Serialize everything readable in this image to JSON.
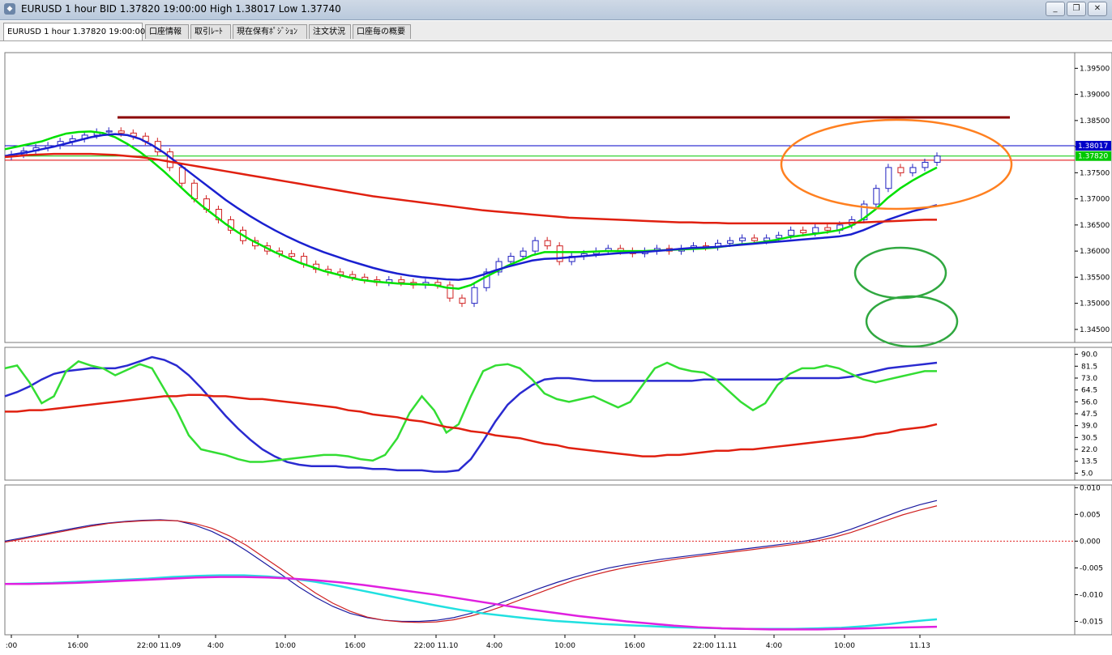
{
  "window": {
    "title": "EURUSD 1 hour BID 1.37820 19:00:00 High 1.38017 Low 1.37740",
    "buttons": [
      "_",
      "❐",
      "✕"
    ]
  },
  "tabs": [
    {
      "label": "EURUSD 1 hour 1.37820 19:00:00",
      "active": true
    },
    {
      "label": "口座情報",
      "active": false
    },
    {
      "label": "取引ﾚｰﾄ",
      "active": false
    },
    {
      "label": "現在保有ﾎﾟｼﾞｼｮﾝ",
      "active": false
    },
    {
      "label": "注文状況",
      "active": false
    },
    {
      "label": "口座毎の概要",
      "active": false
    }
  ],
  "price_axis": {
    "ticks": [
      "1.39500",
      "1.39000",
      "1.38500",
      "1.38000",
      "1.37500",
      "1.37000",
      "1.36500",
      "1.36000",
      "1.35500",
      "1.35000",
      "1.34500"
    ],
    "high_label": "1.38017",
    "current_label": "1.37820",
    "high_color": "#0000c8",
    "current_color": "#00c800"
  },
  "oscillator_axis": {
    "ticks": [
      "90.0",
      "81.5",
      "73.0",
      "64.5",
      "56.0",
      "47.5",
      "39.0",
      "30.5",
      "22.0",
      "13.5",
      "5.0"
    ]
  },
  "macd_axis": {
    "ticks": [
      "0.010",
      "0.005",
      "0.000",
      "-0.005",
      "-0.010",
      "-0.015"
    ]
  },
  "time_axis": {
    "labels": [
      ":00",
      "16:00",
      "22:00 11.09",
      "4:00",
      "10:00",
      "16:00",
      "22:00 11.10",
      "4:00",
      "10:00",
      "16:00",
      "22:00 11.11",
      "4:00",
      "10:00",
      "11.13"
    ]
  },
  "chart_data": {
    "type": "candlestick",
    "symbol": "EURUSD",
    "timeframe": "1 hour",
    "bid": 1.3782,
    "high": 1.38017,
    "low": 1.3774,
    "price_ylim": [
      1.3425,
      1.398
    ],
    "oscillator_ylim": [
      0,
      95
    ],
    "macd_ylim": [
      -0.0175,
      0.0105
    ],
    "candle_interval_hours": 1,
    "first_candle": "2 hours before the 16:00 label",
    "candles_close": [
      1.3785,
      1.3792,
      1.3798,
      1.3802,
      1.381,
      1.3815,
      1.3822,
      1.3828,
      1.383,
      1.3826,
      1.382,
      1.381,
      1.379,
      1.376,
      1.373,
      1.37,
      1.368,
      1.366,
      1.364,
      1.362,
      1.361,
      1.36,
      1.3595,
      1.359,
      1.3575,
      1.3565,
      1.356,
      1.3555,
      1.355,
      1.3545,
      1.354,
      1.3545,
      1.354,
      1.3535,
      1.354,
      1.3535,
      1.351,
      1.35,
      1.353,
      1.356,
      1.358,
      1.359,
      1.36,
      1.362,
      1.361,
      1.358,
      1.359,
      1.3595,
      1.36,
      1.3605,
      1.36,
      1.3595,
      1.36,
      1.3605,
      1.36,
      1.3605,
      1.361,
      1.3608,
      1.3615,
      1.362,
      1.3625,
      1.362,
      1.3625,
      1.363,
      1.364,
      1.3635,
      1.3645,
      1.364,
      1.365,
      1.366,
      1.369,
      1.372,
      1.376,
      1.375,
      1.376,
      1.377,
      1.3782
    ],
    "moving_averages": [
      {
        "color": "#00e000",
        "values": [
          1.3795,
          1.38,
          1.3805,
          1.381,
          1.3818,
          1.3825,
          1.3828,
          1.3829,
          1.3826,
          1.3818,
          1.3805,
          1.379,
          1.3772,
          1.3752,
          1.373,
          1.3708,
          1.3688,
          1.367,
          1.3652,
          1.3636,
          1.3622,
          1.361,
          1.3598,
          1.3588,
          1.3578,
          1.357,
          1.3562,
          1.3556,
          1.355,
          1.3545,
          1.3542,
          1.354,
          1.3538,
          1.3537,
          1.3536,
          1.3535,
          1.353,
          1.3528,
          1.3535,
          1.3548,
          1.356,
          1.3572,
          1.3582,
          1.3592,
          1.3598,
          1.3598,
          1.3598,
          1.3598,
          1.3599,
          1.36,
          1.36,
          1.36,
          1.36,
          1.3601,
          1.3602,
          1.3603,
          1.3604,
          1.3605,
          1.3607,
          1.361,
          1.3613,
          1.3615,
          1.3618,
          1.3622,
          1.3627,
          1.363,
          1.3633,
          1.3636,
          1.364,
          1.3648,
          1.3662,
          1.368,
          1.3702,
          1.372,
          1.3735,
          1.3748,
          1.376
        ]
      },
      {
        "color": "#1a20d0",
        "values": [
          1.3782,
          1.3786,
          1.379,
          1.3795,
          1.38,
          1.3806,
          1.3812,
          1.3818,
          1.3822,
          1.3824,
          1.3822,
          1.3815,
          1.3803,
          1.3788,
          1.377,
          1.3752,
          1.3734,
          1.3716,
          1.3698,
          1.3682,
          1.3667,
          1.3653,
          1.364,
          1.3628,
          1.3617,
          1.3607,
          1.3598,
          1.359,
          1.3582,
          1.3575,
          1.3568,
          1.3562,
          1.3557,
          1.3553,
          1.355,
          1.3548,
          1.3546,
          1.3545,
          1.3548,
          1.3555,
          1.3563,
          1.357,
          1.3576,
          1.3582,
          1.3585,
          1.3586,
          1.3588,
          1.359,
          1.3592,
          1.3594,
          1.3596,
          1.3597,
          1.3598,
          1.36,
          1.3602,
          1.3604,
          1.3606,
          1.3607,
          1.3608,
          1.361,
          1.3612,
          1.3614,
          1.3616,
          1.3618,
          1.362,
          1.3622,
          1.3624,
          1.3626,
          1.3628,
          1.3632,
          1.364,
          1.365,
          1.366,
          1.3668,
          1.3676,
          1.3682,
          1.3688
        ]
      },
      {
        "color": "#e02010",
        "values": [
          1.378,
          1.3782,
          1.3784,
          1.3785,
          1.3786,
          1.3786,
          1.3786,
          1.3786,
          1.3785,
          1.3784,
          1.3782,
          1.378,
          1.3777,
          1.3773,
          1.3769,
          1.3765,
          1.3761,
          1.3757,
          1.3753,
          1.3749,
          1.3745,
          1.3741,
          1.3737,
          1.3733,
          1.3729,
          1.3725,
          1.3721,
          1.3717,
          1.3713,
          1.3709,
          1.3705,
          1.3702,
          1.3699,
          1.3696,
          1.3693,
          1.369,
          1.3687,
          1.3684,
          1.3681,
          1.3678,
          1.3676,
          1.3674,
          1.3672,
          1.367,
          1.3668,
          1.3666,
          1.3664,
          1.3663,
          1.3662,
          1.3661,
          1.366,
          1.3659,
          1.3658,
          1.3657,
          1.3656,
          1.3655,
          1.3655,
          1.3654,
          1.3654,
          1.3653,
          1.3653,
          1.3653,
          1.3653,
          1.3653,
          1.3653,
          1.3653,
          1.3653,
          1.3653,
          1.3653,
          1.3654,
          1.3655,
          1.3656,
          1.3657,
          1.3658,
          1.3659,
          1.366,
          1.366
        ]
      }
    ],
    "horizontal_lines": [
      {
        "value": 1.3856,
        "color": "#8b0000"
      },
      {
        "value": 1.38017,
        "color": "#0000c8"
      },
      {
        "value": 1.3782,
        "color": "#00c800"
      },
      {
        "value": 1.3774,
        "color": "#e00000"
      }
    ],
    "oscillator_series": [
      {
        "color": "#2a2ad0",
        "values": [
          60,
          63,
          67,
          72,
          76,
          78,
          79,
          80,
          80,
          80,
          82,
          85,
          88,
          86,
          82,
          75,
          66,
          56,
          46,
          37,
          29,
          22,
          17,
          13,
          11,
          10,
          10,
          10,
          9,
          9,
          8,
          8,
          7,
          7,
          7,
          6,
          6,
          7,
          15,
          28,
          42,
          54,
          62,
          68,
          72,
          73,
          73,
          72,
          71,
          71,
          71,
          71,
          71,
          71,
          71,
          71,
          71,
          72,
          72,
          72,
          72,
          72,
          72,
          72,
          73,
          73,
          73,
          73,
          73,
          74,
          76,
          78,
          80,
          81,
          82,
          83,
          84
        ]
      },
      {
        "color": "#33dd33",
        "values": [
          80,
          82,
          70,
          55,
          60,
          78,
          85,
          82,
          80,
          75,
          79,
          83,
          80,
          65,
          50,
          32,
          22,
          20,
          18,
          15,
          13,
          13,
          14,
          15,
          16,
          17,
          18,
          18,
          17,
          15,
          14,
          18,
          30,
          48,
          60,
          50,
          34,
          40,
          60,
          78,
          82,
          83,
          80,
          72,
          62,
          58,
          56,
          58,
          60,
          56,
          52,
          56,
          68,
          80,
          84,
          80,
          78,
          77,
          72,
          64,
          56,
          50,
          55,
          68,
          76,
          80,
          80,
          82,
          80,
          76,
          72,
          70,
          72,
          74,
          76,
          78,
          78
        ]
      },
      {
        "color": "#e02010",
        "values": [
          49,
          49,
          50,
          50,
          51,
          52,
          53,
          54,
          55,
          56,
          57,
          58,
          59,
          60,
          60,
          61,
          61,
          60,
          60,
          59,
          58,
          58,
          57,
          56,
          55,
          54,
          53,
          52,
          50,
          49,
          47,
          46,
          45,
          43,
          42,
          40,
          38,
          37,
          35,
          34,
          32,
          31,
          30,
          28,
          26,
          25,
          23,
          22,
          21,
          20,
          19,
          18,
          17,
          17,
          18,
          18,
          19,
          20,
          21,
          21,
          22,
          22,
          23,
          24,
          25,
          26,
          27,
          28,
          29,
          30,
          31,
          33,
          34,
          36,
          37,
          38,
          40
        ]
      }
    ],
    "macd_series": [
      {
        "color": "#1a1aa0",
        "values": [
          0.0,
          0.0006,
          0.0012,
          0.0018,
          0.0024,
          0.003,
          0.0034,
          0.0037,
          0.0039,
          0.004,
          0.0038,
          0.003,
          0.0018,
          0.0002,
          -0.0018,
          -0.004,
          -0.0062,
          -0.0085,
          -0.0105,
          -0.0122,
          -0.0135,
          -0.0143,
          -0.0148,
          -0.015,
          -0.015,
          -0.0148,
          -0.0143,
          -0.0135,
          -0.0124,
          -0.0112,
          -0.01,
          -0.0088,
          -0.0077,
          -0.0067,
          -0.0058,
          -0.005,
          -0.0044,
          -0.0039,
          -0.0034,
          -0.003,
          -0.0026,
          -0.0022,
          -0.0018,
          -0.0014,
          -0.001,
          -0.0006,
          -0.0002,
          0.0004,
          0.0012,
          0.0022,
          0.0034,
          0.0046,
          0.0058,
          0.0068,
          0.0076
        ]
      },
      {
        "color": "#d02020",
        "values": [
          -0.0002,
          0.0004,
          0.001,
          0.0016,
          0.0022,
          0.0028,
          0.0033,
          0.0036,
          0.0038,
          0.0039,
          0.0038,
          0.0033,
          0.0024,
          0.001,
          -0.0008,
          -0.003,
          -0.0052,
          -0.0075,
          -0.0097,
          -0.0116,
          -0.0131,
          -0.0142,
          -0.0148,
          -0.0151,
          -0.0152,
          -0.0151,
          -0.0147,
          -0.014,
          -0.0131,
          -0.012,
          -0.0108,
          -0.0096,
          -0.0084,
          -0.0073,
          -0.0064,
          -0.0056,
          -0.0049,
          -0.0043,
          -0.0038,
          -0.0033,
          -0.0029,
          -0.0025,
          -0.0021,
          -0.0017,
          -0.0013,
          -0.0009,
          -0.0005,
          0.0,
          0.0007,
          0.0016,
          0.0027,
          0.0038,
          0.0049,
          0.0058,
          0.0066
        ]
      },
      {
        "color": "#20e0e0",
        "values": [
          -0.008,
          -0.0079,
          -0.0078,
          -0.0076,
          -0.0074,
          -0.0072,
          -0.007,
          -0.0067,
          -0.0065,
          -0.0064,
          -0.0064,
          -0.0066,
          -0.007,
          -0.0076,
          -0.0084,
          -0.0093,
          -0.0102,
          -0.0111,
          -0.012,
          -0.0128,
          -0.0135,
          -0.014,
          -0.0145,
          -0.0149,
          -0.0152,
          -0.0155,
          -0.0157,
          -0.0159,
          -0.0161,
          -0.0162,
          -0.0163,
          -0.0164,
          -0.0164,
          -0.0164,
          -0.0163,
          -0.0162,
          -0.0159,
          -0.0155,
          -0.015,
          -0.0146
        ]
      },
      {
        "color": "#e020e0",
        "values": [
          -0.008,
          -0.008,
          -0.0079,
          -0.0078,
          -0.0076,
          -0.0074,
          -0.0072,
          -0.007,
          -0.0068,
          -0.0067,
          -0.0067,
          -0.0068,
          -0.007,
          -0.0073,
          -0.0077,
          -0.0082,
          -0.0088,
          -0.0094,
          -0.01,
          -0.0107,
          -0.0114,
          -0.0121,
          -0.0128,
          -0.0134,
          -0.014,
          -0.0145,
          -0.015,
          -0.0154,
          -0.0158,
          -0.0161,
          -0.0163,
          -0.0164,
          -0.0165,
          -0.0165,
          -0.0165,
          -0.0164,
          -0.0163,
          -0.0162,
          -0.0161,
          -0.016
        ]
      }
    ],
    "annotations": [
      {
        "shape": "ellipse",
        "color": "#ff8020"
      },
      {
        "shape": "ellipse",
        "color": "#30a840"
      },
      {
        "shape": "ellipse",
        "color": "#30a840"
      }
    ],
    "grid": false
  }
}
